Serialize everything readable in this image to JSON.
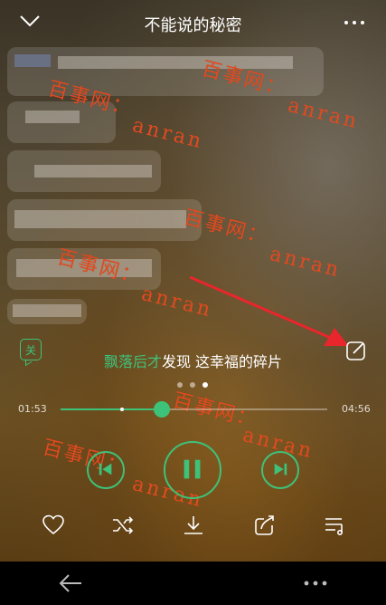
{
  "header": {
    "title": "不能说的秘密"
  },
  "lyrics": {
    "toggle_label": "关",
    "current_highlight": "飘落后才",
    "current_rest": "发现 这幸福的碎片"
  },
  "pager": {
    "count": 3,
    "active_index": 2
  },
  "progress": {
    "elapsed": "01:53",
    "total": "04:56",
    "fraction": 0.38,
    "buffer_mark_fraction": 0.23
  },
  "watermark": {
    "text_main": "百事网：",
    "text_sub": "anran"
  },
  "colors": {
    "accent": "#3ec27a",
    "watermark": "#e24a1f",
    "arrow": "#e8262c"
  },
  "icons": {
    "collapse": "chevron-down-icon",
    "more": "more-dots-icon",
    "edit": "edit-icon",
    "prev": "skip-previous-icon",
    "play_pause": "pause-icon",
    "next": "skip-next-icon",
    "like": "heart-icon",
    "shuffle": "shuffle-icon",
    "download": "download-icon",
    "share": "share-icon",
    "playlist": "playlist-icon",
    "nav_back": "arrow-left-icon"
  }
}
